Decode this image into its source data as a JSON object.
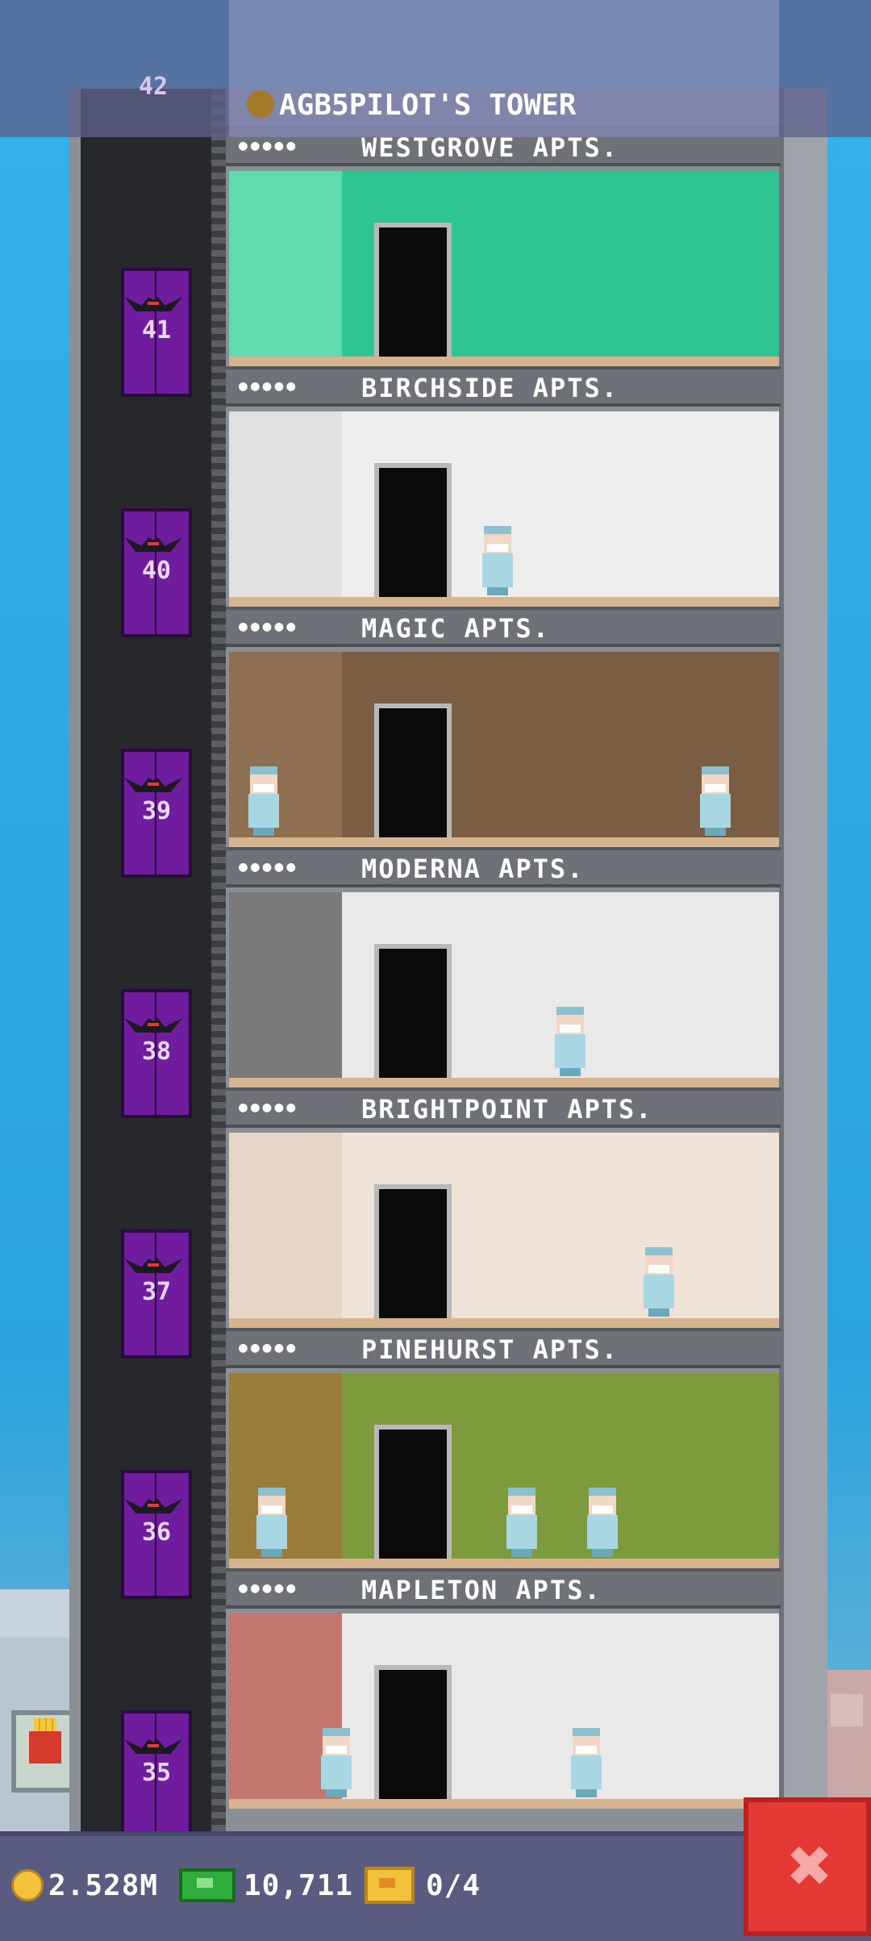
{
  "tower": {
    "title": "AGB5PILOT'S TOWER",
    "top_floor_number": "42"
  },
  "floors": [
    {
      "number": "41",
      "label_people": "●●●●●",
      "name": "WESTGROVE APTS.",
      "room_bg": "#2ec592",
      "room_accent": "#78e3bb"
    },
    {
      "number": "40",
      "label_people": "●●●●●",
      "name": "BIRCHSIDE APTS.",
      "room_bg": "#eeeeee",
      "room_accent": "#dcdcdc"
    },
    {
      "number": "39",
      "label_people": "●●●●●",
      "name": "MAGIC APTS.",
      "room_bg": "#7a5d42",
      "room_accent": "#98785a"
    },
    {
      "number": "38",
      "label_people": "●●●●●",
      "name": "MODERNA APTS.",
      "room_bg": "#e9e9e9",
      "room_accent": "#4a4a4a"
    },
    {
      "number": "37",
      "label_people": "●●●●●",
      "name": "BRIGHTPOINT APTS.",
      "room_bg": "#efe2d6",
      "room_accent": "#e3d1c1"
    },
    {
      "number": "36",
      "label_people": "●●●●●",
      "name": "PINEHURST APTS.",
      "room_bg": "#7d9a3c",
      "room_accent": "#a56f3c"
    },
    {
      "number": "35",
      "label_people": "●●●●●",
      "name": "MAPLETON APTS.",
      "room_bg": "#e9e9e9",
      "room_accent": "#b3463a"
    }
  ],
  "hud": {
    "coins": "2.528M",
    "bux": "10,711",
    "tickets": "0/4",
    "close_symbol": "✖"
  },
  "colors": {
    "sky": "#2ea9e3",
    "elevator": "#6f1d9e",
    "hud": "#5a5b80",
    "close_button": "#e53936"
  }
}
